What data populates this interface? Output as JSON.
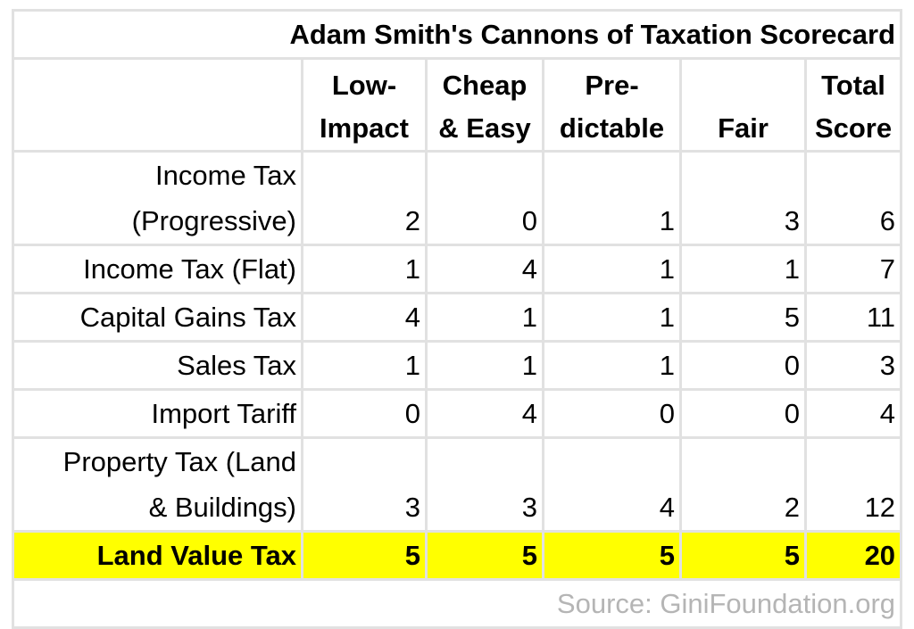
{
  "title": "Adam Smith's Cannons of Taxation Scorecard",
  "columns": [
    {
      "line1": "Low-",
      "line2": "Impact"
    },
    {
      "line1": "Cheap",
      "line2": "& Easy"
    },
    {
      "line1": "Pre-",
      "line2": "dictable"
    },
    {
      "line1": "",
      "line2": "Fair"
    },
    {
      "line1": "Total",
      "line2": "Score"
    }
  ],
  "rows": [
    {
      "label_line1": "Income Tax",
      "label_line2": "(Progressive)",
      "values": [
        "2",
        "0",
        "1",
        "3",
        "6"
      ]
    },
    {
      "label_line1": "",
      "label_line2": "Income Tax (Flat)",
      "values": [
        "1",
        "4",
        "1",
        "1",
        "7"
      ]
    },
    {
      "label_line1": "",
      "label_line2": "Capital Gains Tax",
      "values": [
        "4",
        "1",
        "1",
        "5",
        "11"
      ]
    },
    {
      "label_line1": "",
      "label_line2": "Sales Tax",
      "values": [
        "1",
        "1",
        "1",
        "0",
        "3"
      ]
    },
    {
      "label_line1": "",
      "label_line2": "Import Tariff",
      "values": [
        "0",
        "4",
        "0",
        "0",
        "4"
      ]
    },
    {
      "label_line1": "Property Tax (Land",
      "label_line2": "& Buildings)",
      "values": [
        "3",
        "3",
        "4",
        "2",
        "12"
      ]
    },
    {
      "label_line1": "",
      "label_line2": "Land Value Tax",
      "values": [
        "5",
        "5",
        "5",
        "5",
        "20"
      ]
    }
  ],
  "highlight_row_color": "#ffff00",
  "source": "Source: GiniFoundation.org"
}
